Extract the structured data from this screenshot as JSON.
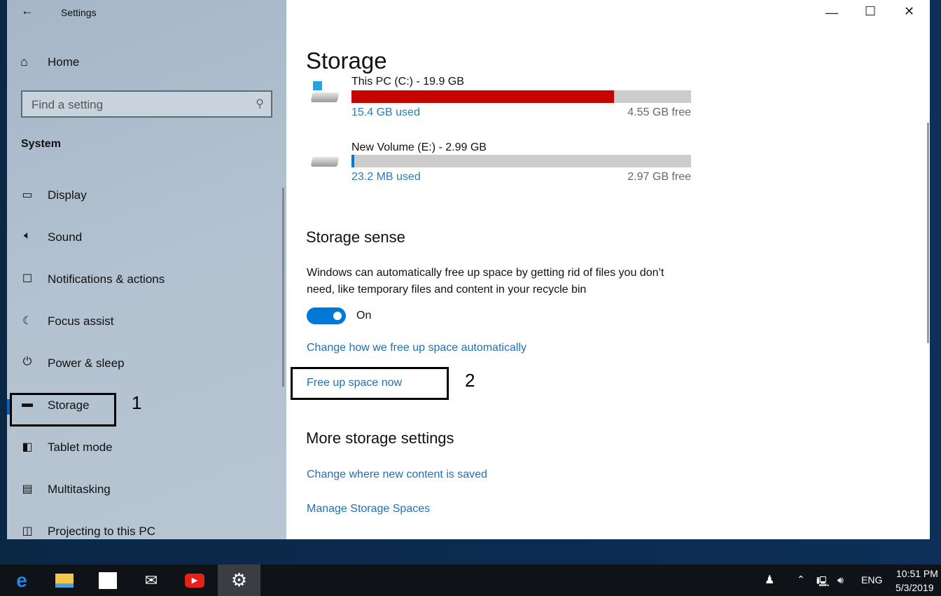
{
  "window": {
    "title": "Settings",
    "controls": [
      "minimize",
      "maximize",
      "close"
    ]
  },
  "sidebar": {
    "home": "Home",
    "search_placeholder": "Find a setting",
    "section": "System",
    "items": [
      {
        "label": "Display",
        "icon": "monitor-icon"
      },
      {
        "label": "Sound",
        "icon": "speaker-icon"
      },
      {
        "label": "Notifications & actions",
        "icon": "notification-icon"
      },
      {
        "label": "Focus assist",
        "icon": "moon-icon"
      },
      {
        "label": "Power & sleep",
        "icon": "power-icon"
      },
      {
        "label": "Storage",
        "icon": "storage-icon",
        "selected": true
      },
      {
        "label": "Tablet mode",
        "icon": "tablet-icon"
      },
      {
        "label": "Multitasking",
        "icon": "multitasking-icon"
      },
      {
        "label": "Projecting to this PC",
        "icon": "projecting-icon"
      }
    ]
  },
  "main": {
    "title": "Storage",
    "drives": [
      {
        "name": "This PC (C:) - 19.9 GB",
        "used": "15.4 GB used",
        "free": "4.55 GB free",
        "used_fraction": 0.774,
        "color": "#c50500"
      },
      {
        "name": "New Volume (E:) - 2.99 GB",
        "used": "23.2 MB used",
        "free": "2.97 GB free",
        "used_fraction": 0.008,
        "color": "#0078d7"
      }
    ],
    "storage_sense": {
      "heading": "Storage sense",
      "description": "Windows can automatically free up space by getting rid of files you don’t need, like temporary files and content in your recycle bin",
      "toggle_state": "On",
      "link_change": "Change how we free up space automatically",
      "link_free": "Free up space now"
    },
    "more": {
      "heading": "More storage settings",
      "links": [
        "Change where new content is saved",
        "Manage Storage Spaces"
      ]
    }
  },
  "annotations": {
    "one": "1",
    "two": "2"
  },
  "taskbar": {
    "apps": [
      "edge-icon",
      "file-explorer-icon",
      "store-icon",
      "mail-icon",
      "youtube-icon",
      "settings-icon"
    ],
    "language": "ENG",
    "time": "10:51 PM",
    "date": "5/3/2019"
  },
  "colors": {
    "accent": "#0078d7",
    "link": "#1f6fb5",
    "drive_full": "#c50500"
  }
}
